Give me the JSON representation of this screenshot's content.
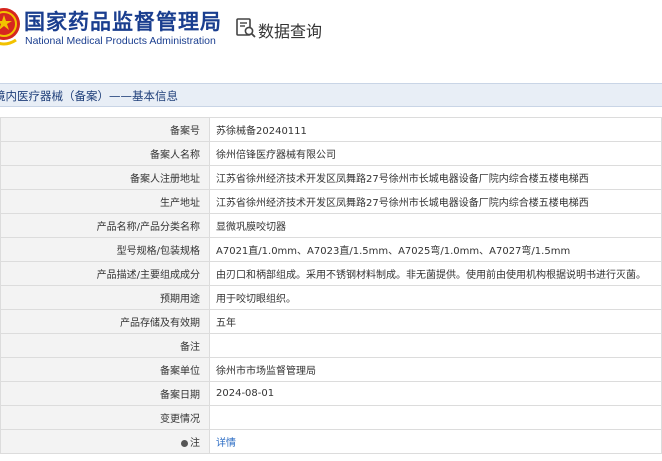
{
  "header": {
    "brand_cn": "国家药品监督管理局",
    "brand_en": "National Medical Products Administration",
    "search_title": "数据查询"
  },
  "section": {
    "title": "境内医疗器械（备案）——基本信息"
  },
  "rows": [
    {
      "label": "备案号",
      "value": "苏徐械备20240111"
    },
    {
      "label": "备案人名称",
      "value": "徐州倍锋医疗器械有限公司"
    },
    {
      "label": "备案人注册地址",
      "value": "江苏省徐州经济技术开发区凤舞路27号徐州市长城电器设备厂院内综合楼五楼电梯西"
    },
    {
      "label": "生产地址",
      "value": "江苏省徐州经济技术开发区凤舞路27号徐州市长城电器设备厂院内综合楼五楼电梯西"
    },
    {
      "label": "产品名称/产品分类名称",
      "value": "显微巩膜咬切器"
    },
    {
      "label": "型号规格/包装规格",
      "value": "A7021直/1.0mm、A7023直/1.5mm、A7025弯/1.0mm、A7027弯/1.5mm"
    },
    {
      "label": "产品描述/主要组成成分",
      "value": "由刃口和柄部组成。采用不锈钢材料制成。非无菌提供。使用前由使用机构根据说明书进行灭菌。"
    },
    {
      "label": "预期用途",
      "value": "用于咬切眼组织。"
    },
    {
      "label": "产品存储及有效期",
      "value": "五年"
    },
    {
      "label": "备注",
      "value": ""
    },
    {
      "label": "备案单位",
      "value": "徐州市市场监督管理局"
    },
    {
      "label": "备案日期",
      "value": "2024-08-01"
    },
    {
      "label": "变更情况",
      "value": ""
    },
    {
      "label": "注",
      "value": "详情"
    }
  ],
  "colors": {
    "brand": "#1a3e8f",
    "link": "#2b6cc4",
    "label_bg": "#f3f3f3",
    "titlebar_bg": "#e8eef6"
  },
  "icons": [
    "emblem-icon",
    "search-icon",
    "note-dot-icon"
  ]
}
